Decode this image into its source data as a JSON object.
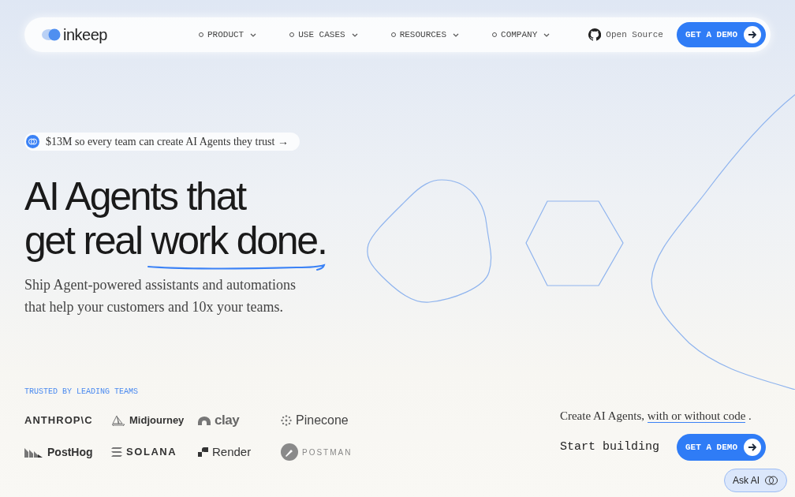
{
  "nav": {
    "logo": "inkeep",
    "items": [
      {
        "label": "PRODUCT"
      },
      {
        "label": "USE CASES"
      },
      {
        "label": "RESOURCES"
      },
      {
        "label": "COMPANY"
      }
    ],
    "open_source": "Open Source",
    "cta": "GET A DEMO"
  },
  "announcement": "$13M so every team can create AI Agents they trust →",
  "headline": {
    "line_1": "AI Agents that",
    "line_2": "get real",
    "highlight": "work done",
    "end": "."
  },
  "subtitle": "Ship Agent-powered assistants and automations that help your customers and 10x your teams.",
  "trusted": {
    "title": "TRUSTED BY LEADING TEAMS",
    "logos": [
      {
        "name": "ANTHROP\\C",
        "kind": "wordmark"
      },
      {
        "name": "Midjourney",
        "kind": "sailboat"
      },
      {
        "name": "clay",
        "kind": "dome"
      },
      {
        "name": "Pinecone",
        "kind": "dots"
      },
      {
        "name": "PostHog",
        "kind": "stripes"
      },
      {
        "name": "SOLANA",
        "kind": "bars"
      },
      {
        "name": "Render",
        "kind": "blocks"
      },
      {
        "name": "POSTMAN",
        "kind": "circle"
      }
    ]
  },
  "cta": {
    "text": "Create AI Agents,",
    "link": "with or without code",
    "end": ".",
    "start": "Start building",
    "button": "GET A DEMO"
  },
  "ask_ai": "Ask AI"
}
